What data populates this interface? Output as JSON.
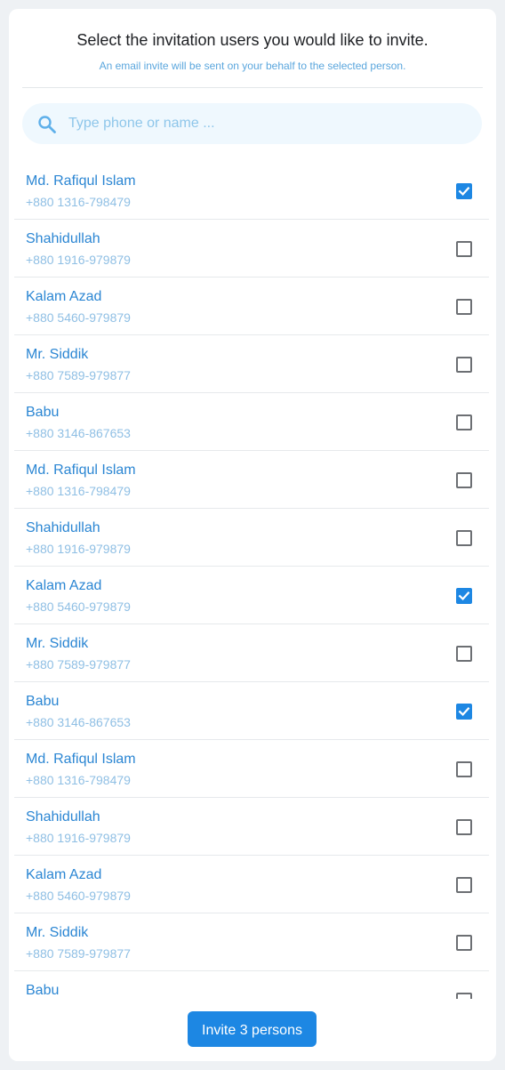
{
  "header": {
    "title": "Select the invitation users you would like to invite.",
    "subtitle": "An email invite will be sent on your behalf to the selected person."
  },
  "search": {
    "placeholder": "Type phone or name ...",
    "value": ""
  },
  "contacts": [
    {
      "name": "Md. Rafiqul Islam",
      "phone": "+880 1316-798479",
      "checked": true
    },
    {
      "name": "Shahidullah",
      "phone": "+880 1916-979879",
      "checked": false
    },
    {
      "name": "Kalam Azad",
      "phone": "+880 5460-979879",
      "checked": false
    },
    {
      "name": "Mr. Siddik",
      "phone": "+880 7589-979877",
      "checked": false
    },
    {
      "name": "Babu",
      "phone": "+880 3146-867653",
      "checked": false
    },
    {
      "name": "Md. Rafiqul Islam",
      "phone": "+880 1316-798479",
      "checked": false
    },
    {
      "name": "Shahidullah",
      "phone": "+880 1916-979879",
      "checked": false
    },
    {
      "name": "Kalam Azad",
      "phone": "+880 5460-979879",
      "checked": true
    },
    {
      "name": "Mr. Siddik",
      "phone": "+880 7589-979877",
      "checked": false
    },
    {
      "name": "Babu",
      "phone": "+880 3146-867653",
      "checked": true
    },
    {
      "name": "Md. Rafiqul Islam",
      "phone": "+880 1316-798479",
      "checked": false
    },
    {
      "name": "Shahidullah",
      "phone": "+880 1916-979879",
      "checked": false
    },
    {
      "name": "Kalam Azad",
      "phone": "+880 5460-979879",
      "checked": false
    },
    {
      "name": "Mr. Siddik",
      "phone": "+880 7589-979877",
      "checked": false
    },
    {
      "name": "Babu",
      "phone": "",
      "checked": false
    }
  ],
  "footer": {
    "invite_label": "Invite 3 persons"
  },
  "icons": {
    "search": "search-icon",
    "checkbox_checked": "check-icon"
  },
  "colors": {
    "accent": "#1d87e3",
    "name_text": "#2b86d3",
    "phone_text": "#8fbfe4",
    "search_bg": "#eff8fe"
  }
}
